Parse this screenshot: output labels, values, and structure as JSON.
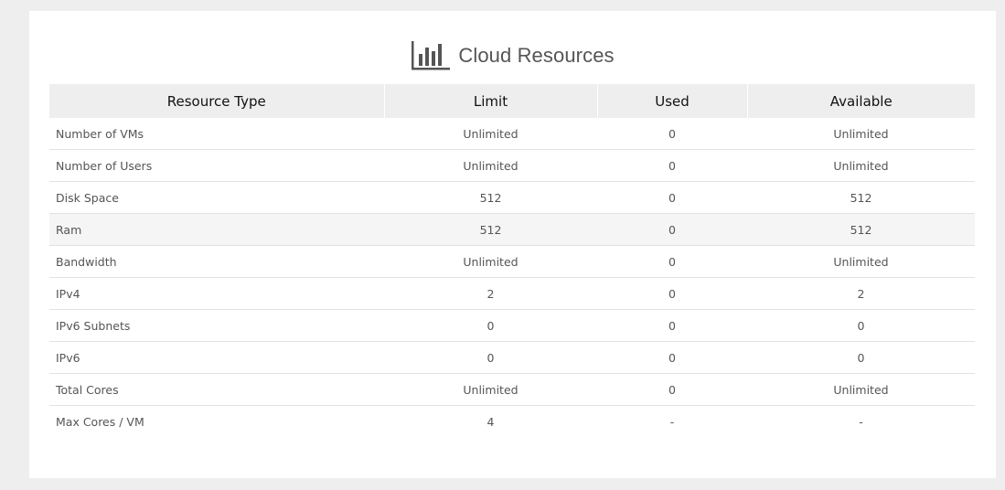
{
  "header": {
    "icon": "bar-chart-icon",
    "title": "Cloud Resources"
  },
  "table": {
    "columns": [
      "Resource Type",
      "Limit",
      "Used",
      "Available"
    ],
    "rows": [
      {
        "type": "Number of VMs",
        "limit": "Unlimited",
        "used": "0",
        "available": "Unlimited"
      },
      {
        "type": "Number of Users",
        "limit": "Unlimited",
        "used": "0",
        "available": "Unlimited"
      },
      {
        "type": "Disk Space",
        "limit": "512",
        "used": "0",
        "available": "512"
      },
      {
        "type": "Ram",
        "limit": "512",
        "used": "0",
        "available": "512"
      },
      {
        "type": "Bandwidth",
        "limit": "Unlimited",
        "used": "0",
        "available": "Unlimited"
      },
      {
        "type": "IPv4",
        "limit": "2",
        "used": "0",
        "available": "2"
      },
      {
        "type": "IPv6 Subnets",
        "limit": "0",
        "used": "0",
        "available": "0"
      },
      {
        "type": "IPv6",
        "limit": "0",
        "used": "0",
        "available": "0"
      },
      {
        "type": "Total Cores",
        "limit": "Unlimited",
        "used": "0",
        "available": "Unlimited"
      },
      {
        "type": "Max Cores / VM",
        "limit": "4",
        "used": "-",
        "available": "-"
      }
    ],
    "highlighted_row": "Ram"
  },
  "colors": {
    "header_bg": "#eeeeee",
    "panel_bg": "#ffffff",
    "page_bg": "#eeeeee",
    "text": "#555555",
    "header_text": "#111111",
    "row_highlight": "#f5f5f5"
  }
}
